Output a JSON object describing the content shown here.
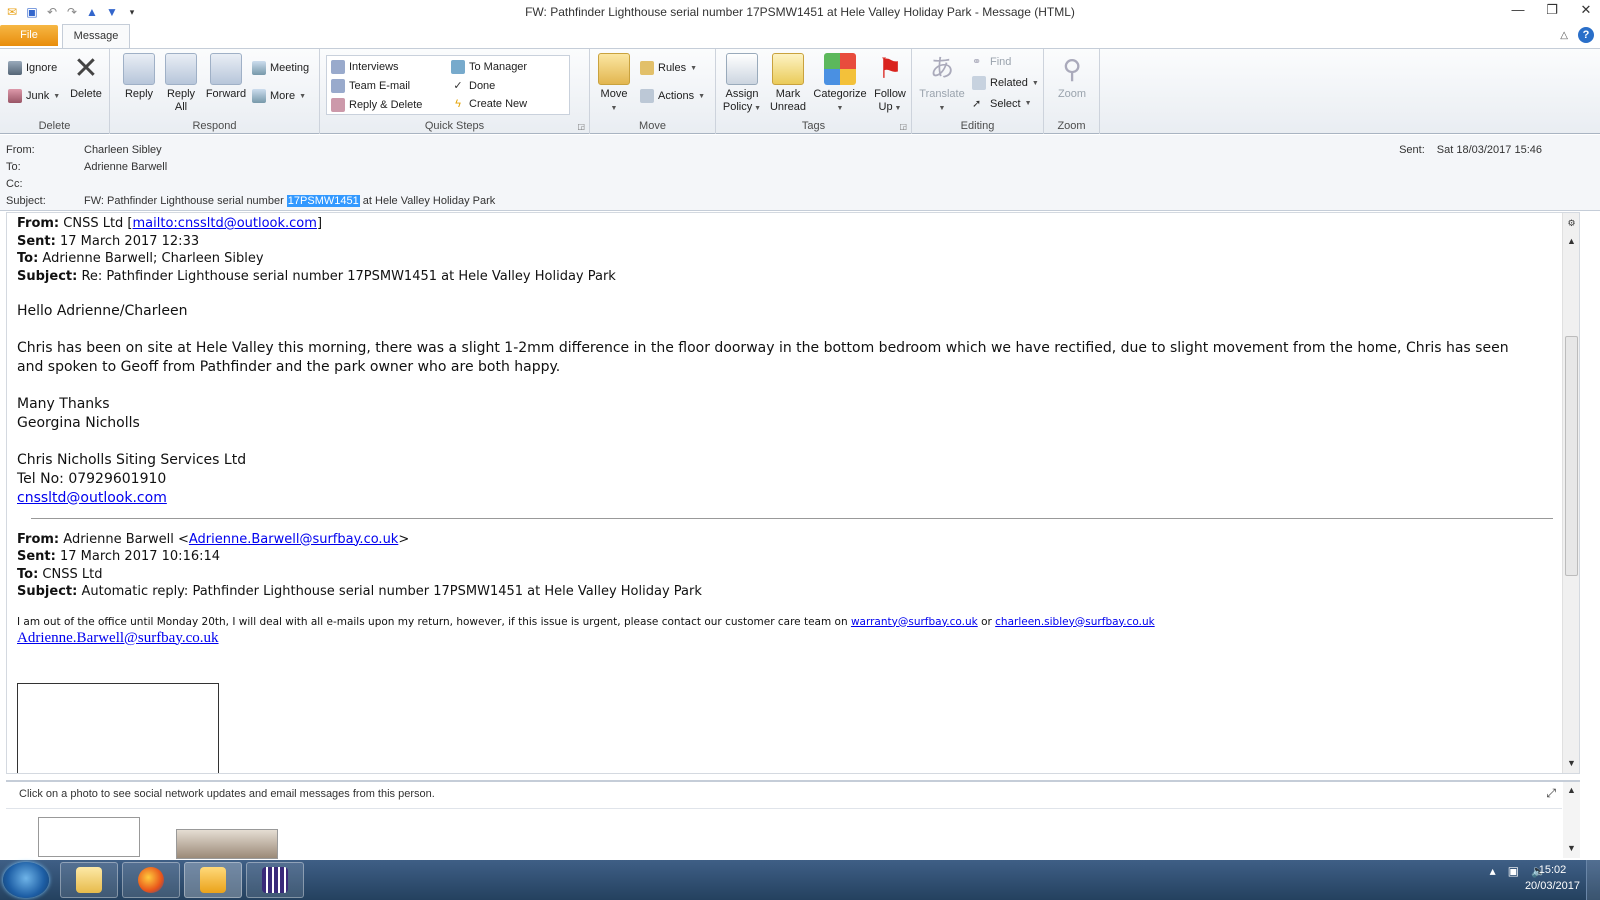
{
  "window": {
    "title": "FW: Pathfinder Lighthouse serial number 17PSMW1451 at Hele Valley Holiday Park  -  Message (HTML)"
  },
  "tabs": {
    "file": "File",
    "message": "Message"
  },
  "ribbon": {
    "delete_group": {
      "label": "Delete",
      "ignore": "Ignore",
      "junk": "Junk",
      "delete": "Delete"
    },
    "respond_group": {
      "label": "Respond",
      "reply": "Reply",
      "reply_all_1": "Reply",
      "reply_all_2": "All",
      "forward": "Forward",
      "meeting": "Meeting",
      "more": "More"
    },
    "quicksteps_group": {
      "label": "Quick Steps",
      "items": [
        "Interviews",
        "Team E-mail",
        "Reply & Delete",
        "To Manager",
        "Done",
        "Create New"
      ]
    },
    "move_group": {
      "label": "Move",
      "move": "Move",
      "rules": "Rules",
      "actions": "Actions"
    },
    "tags_group": {
      "label": "Tags",
      "assign_1": "Assign",
      "assign_2": "Policy",
      "mark_1": "Mark",
      "mark_2": "Unread",
      "categorize": "Categorize",
      "follow_1": "Follow",
      "follow_2": "Up"
    },
    "editing_group": {
      "label": "Editing",
      "translate": "Translate",
      "find": "Find",
      "related": "Related",
      "select": "Select"
    },
    "zoom_group": {
      "label": "Zoom",
      "zoom": "Zoom"
    }
  },
  "header": {
    "from_label": "From:",
    "from": "Charleen Sibley",
    "to_label": "To:",
    "to": "Adrienne Barwell",
    "cc_label": "Cc:",
    "subject_label": "Subject:",
    "subject_pre": "FW: Pathfinder Lighthouse serial number ",
    "subject_highlight": "17PSMW1451",
    "subject_post": " at Hele Valley Holiday Park",
    "sent_label": "Sent:",
    "sent": "Sat 18/03/2017 15:46"
  },
  "body": {
    "m1_from_label": "From:",
    "m1_from": " CNSS Ltd [",
    "m1_from_link": "mailto:cnssltd@outlook.com",
    "m1_from_end": "]",
    "m1_sent_label": "Sent:",
    "m1_sent": " 17 March 2017 12:33",
    "m1_to_label": "To:",
    "m1_to": " Adrienne Barwell; Charleen Sibley",
    "m1_subject_label": "Subject:",
    "m1_subject": " Re: Pathfinder Lighthouse serial number 17PSMW1451 at Hele Valley Holiday Park",
    "greeting": "Hello Adrienne/Charleen",
    "para": "Chris has been on site at Hele Valley this morning, there was a slight 1-2mm difference in the floor doorway in the bottom bedroom which we have rectified, due to slight movement from the home, Chris has seen and spoken to Geoff from Pathfinder and the park owner who are both happy.",
    "thanks": "Many Thanks",
    "signer": "Georgina Nicholls",
    "company": "Chris Nicholls Siting Services Ltd",
    "tel": "Tel No: 07929601910",
    "email": "cnssltd@outlook.com",
    "m2_from_label": "From:",
    "m2_from": " Adrienne Barwell <",
    "m2_from_link": "Adrienne.Barwell@surfbay.co.uk",
    "m2_from_end": ">",
    "m2_sent_label": "Sent:",
    "m2_sent": " 17 March 2017 10:16:14",
    "m2_to_label": "To:",
    "m2_to": " CNSS Ltd",
    "m2_subject_label": "Subject:",
    "m2_subject": " Automatic reply: Pathfinder Lighthouse serial number 17PSMW1451 at Hele Valley Holiday Park",
    "auto_text": "I am out of the office until Monday 20th, I will deal with all e-mails upon my return, however, if this issue is urgent, please contact our customer care team on ",
    "auto_link1": "warranty@surfbay.co.uk",
    "auto_or": " or ",
    "auto_link2": "charleen.sibley@surfbay.co.uk",
    "auto_sig_link": "Adrienne.Barwell@surfbay.co.uk"
  },
  "social": {
    "message": "Click on a photo to see social network updates and email messages from this person."
  },
  "taskbar": {
    "time": "15:02",
    "date": "20/03/2017"
  }
}
